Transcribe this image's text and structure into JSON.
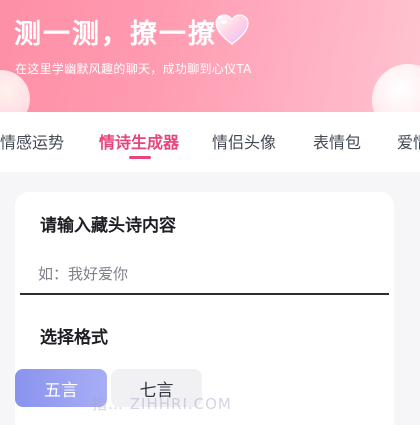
{
  "header": {
    "title": "测一测，撩一撩",
    "subtitle": "在这里学幽默风趣的聊天，成功聊到心仪TA",
    "icon": "heart-icon"
  },
  "tabs": [
    {
      "label": "情感运势",
      "active": false
    },
    {
      "label": "情诗生成器",
      "active": true
    },
    {
      "label": "情侣头像",
      "active": false
    },
    {
      "label": "表情包",
      "active": false
    },
    {
      "label": "爱情",
      "active": false
    }
  ],
  "form": {
    "poem_label": "请输入藏头诗内容",
    "poem_placeholder": "如：我好爱你",
    "poem_value": "",
    "format_label": "选择格式",
    "format_options": [
      {
        "label": "五言",
        "selected": true
      },
      {
        "label": "七言",
        "selected": false
      }
    ]
  },
  "watermark": "指… ZIHHRI.COM",
  "colors": {
    "accent": "#e7457a",
    "header_gradient_start": "#fd8fa6",
    "button_active": "#8a93ee"
  }
}
